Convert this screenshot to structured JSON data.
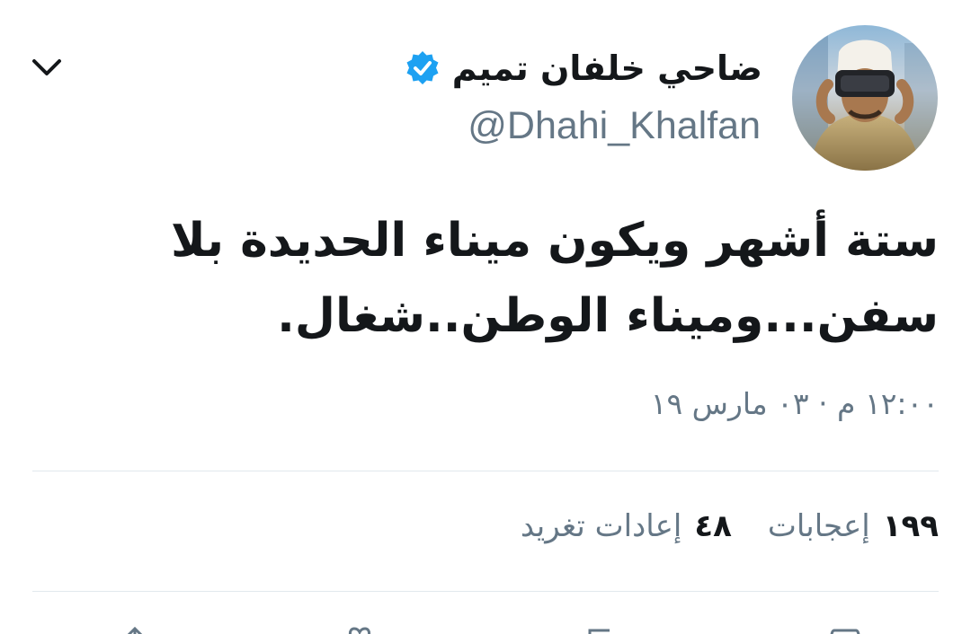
{
  "author": {
    "name": "ضاحي خلفان تميم",
    "handle": "@Dhahi_Khalfan",
    "verified": true
  },
  "tweet": {
    "text": "ستة أشهر ويكون ميناء الحديدة بلا سفن...وميناء الوطن..شغال.",
    "timestamp": "١٢:٠٠ م · ٠٣ مارس ١٩"
  },
  "stats": {
    "retweets_count": "٤٨",
    "retweets_label": "إعادات تغريد",
    "likes_count": "١٩٩",
    "likes_label": "إعجابات"
  },
  "icons": {
    "menu": "chevron-down-icon",
    "verified": "verified-badge-icon"
  },
  "colors": {
    "primary_text": "#14171a",
    "secondary_text": "#657786",
    "verified_blue": "#1da1f2",
    "divider": "#e1e8ed"
  }
}
